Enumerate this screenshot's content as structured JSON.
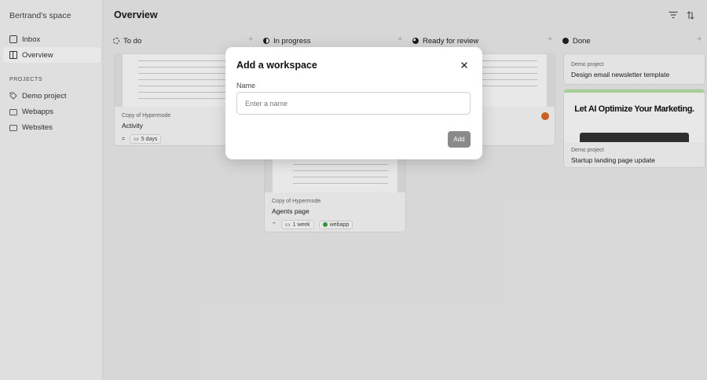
{
  "sidebar": {
    "workspace_name": "Bertrand's space",
    "nav": [
      {
        "label": "Inbox",
        "icon": "inbox-icon"
      },
      {
        "label": "Overview",
        "icon": "board-icon",
        "active": true
      }
    ],
    "projects_label": "PROJECTS",
    "projects": [
      {
        "label": "Demo project",
        "icon": "tag-icon"
      },
      {
        "label": "Webapps",
        "icon": "folder-icon"
      },
      {
        "label": "Websites",
        "icon": "folder-icon"
      }
    ]
  },
  "header": {
    "title": "Overview",
    "filter_icon": "filter-icon",
    "sort_icon": "sort-icon"
  },
  "columns": [
    {
      "label": "To do",
      "status_color": "#ffffff"
    },
    {
      "label": "In progress",
      "status_color": "#222222"
    },
    {
      "label": "Ready for review",
      "status_color": "#222222"
    },
    {
      "label": "Done",
      "status_color": "#222222"
    }
  ],
  "cards": {
    "activity": {
      "project": "Copy of Hypermode",
      "title": "Activity",
      "duration": "5 days",
      "priority_icon": "equals-icon"
    },
    "agents": {
      "project": "Copy of Hypermode",
      "title": "Agents page",
      "duration": "1 week",
      "tag": "webapp",
      "priority_icon": "chevrons-up-icon"
    },
    "newsletter": {
      "project": "Demo project",
      "title": "Design email newsletter template"
    },
    "landing": {
      "project": "Demo project",
      "title": "Startup landing page update",
      "thumb_headline": "Let AI Optimize Your Marketing."
    }
  },
  "modal": {
    "title": "Add a workspace",
    "name_label": "Name",
    "name_placeholder": "Enter a name",
    "name_value": "",
    "add_label": "Add",
    "close_icon": "close-icon"
  },
  "colors": {
    "accent_orange": "#e0692a",
    "tag_green": "#3aa24a",
    "button_gray": "#8a8a8a"
  }
}
